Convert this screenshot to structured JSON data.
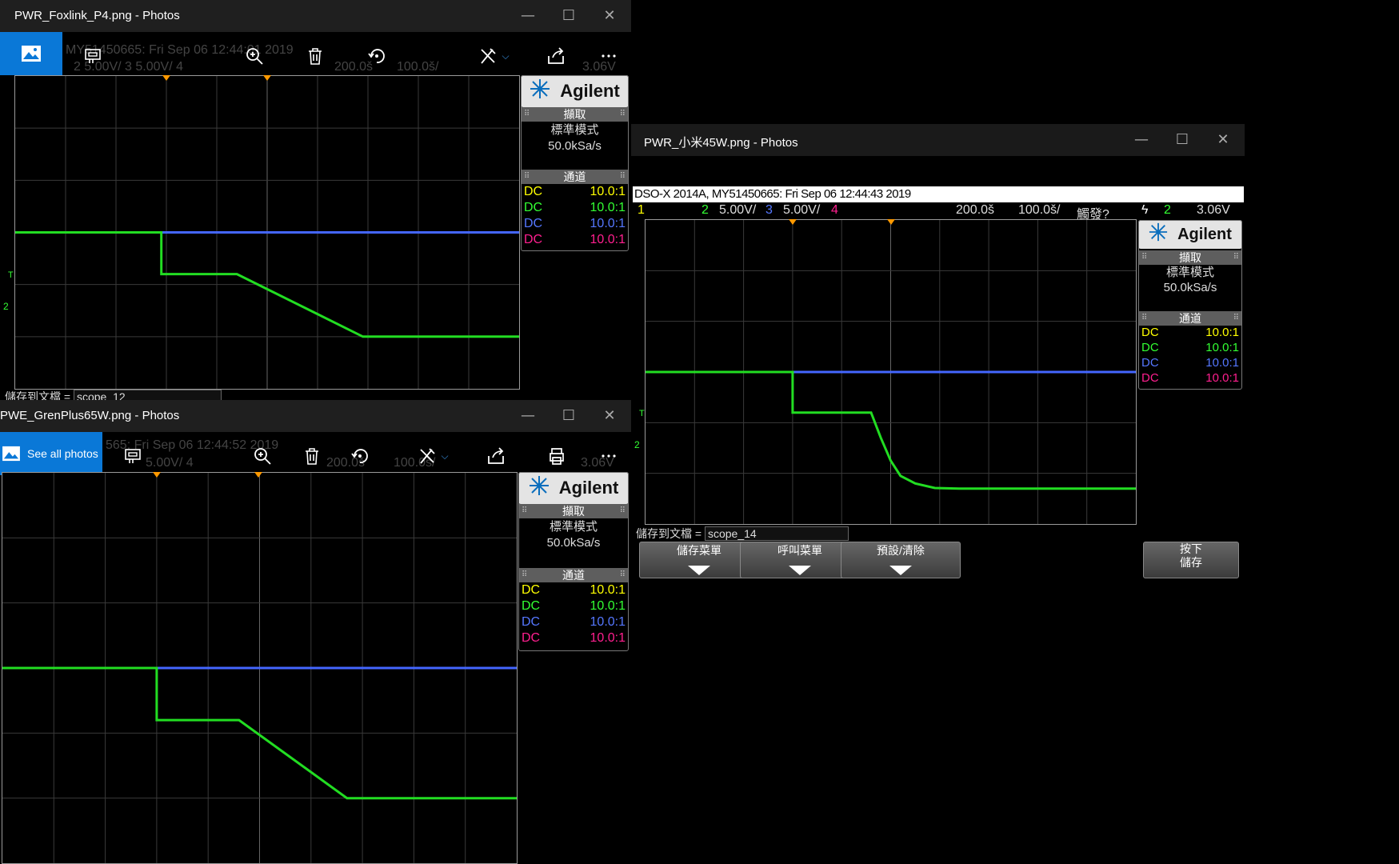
{
  "windows": {
    "foxlink": {
      "title": "PWR_Foxlink_P4.png - Photos",
      "ghost_header": "MY51450665: Fri Sep 06 12:44:01 2019",
      "ghost_status": "2   5.00V/   3   5.00V/   4",
      "ghost_time": "200.0š",
      "ghost_pos": "100.0š/",
      "ghost_trig": "3.06V",
      "save_label": "儲存到文檔 =",
      "save_value": "scope_12",
      "panel": {
        "brand": "Agilent",
        "acq_header": "擷取",
        "mode": "標準模式",
        "rate": "50.0kSa/s",
        "ch_header": "通道",
        "channels": [
          {
            "coupling": "DC",
            "ratio": "10.0:1"
          },
          {
            "coupling": "DC",
            "ratio": "10.0:1"
          },
          {
            "coupling": "DC",
            "ratio": "10.0:1"
          },
          {
            "coupling": "DC",
            "ratio": "10.0:1"
          }
        ]
      }
    },
    "grenplus": {
      "title": "PWE_GrenPlus65W.png - Photos",
      "see_all": "See all photos",
      "ghost_header": "565: Fri Sep 06 12:44:52 2019",
      "ghost_status": "5.00V/   4",
      "ghost_time": "200.0š",
      "ghost_pos": "100.0š/",
      "ghost_trig": "3.06V",
      "panel": {
        "brand": "Agilent",
        "acq_header": "擷取",
        "mode": "標準模式",
        "rate": "50.0kSa/s",
        "ch_header": "通道",
        "channels": [
          {
            "coupling": "DC",
            "ratio": "10.0:1"
          },
          {
            "coupling": "DC",
            "ratio": "10.0:1"
          },
          {
            "coupling": "DC",
            "ratio": "10.0:1"
          },
          {
            "coupling": "DC",
            "ratio": "10.0:1"
          }
        ]
      }
    },
    "xiaomi": {
      "title": "PWR_小米45W.png - Photos",
      "header": "DSO-X 2014A, MY51450665: Fri Sep 06 12:44:43 2019",
      "status": {
        "ch1": "1",
        "ch2": "2",
        "ch2_scale": "5.00V/",
        "ch3": "3",
        "ch3_scale": "5.00V/",
        "ch4": "4",
        "time_scale": "200.0š",
        "delay": "100.0š/",
        "trig_status": "觸發?",
        "trig_icon": "ϟ",
        "trig_ch": "2",
        "trig_level": "3.06V"
      },
      "save_label": "儲存到文檔 =",
      "save_value": "scope_14",
      "buttons": [
        "儲存菜單",
        "呼叫菜單",
        "預設/清除"
      ],
      "press_button": [
        "按下",
        "儲存"
      ],
      "panel": {
        "brand": "Agilent",
        "acq_header": "擷取",
        "mode": "標準模式",
        "rate": "50.0kSa/s",
        "ch_header": "通道",
        "channels": [
          {
            "coupling": "DC",
            "ratio": "10.0:1"
          },
          {
            "coupling": "DC",
            "ratio": "10.0:1"
          },
          {
            "coupling": "DC",
            "ratio": "10.0:1"
          },
          {
            "coupling": "DC",
            "ratio": "10.0:1"
          }
        ]
      }
    }
  },
  "window_controls": {
    "minimize": "—",
    "maximize": "☐",
    "close": "✕"
  },
  "toolbar_icons": [
    "photo-icon",
    "slideshow-icon",
    "zoom-icon",
    "delete-icon",
    "rotate-icon",
    "edit-icon",
    "share-icon",
    "print-icon",
    "more-icon"
  ],
  "colors": {
    "ch1": "#ffff00",
    "ch2": "#33ff33",
    "ch3": "#5577ff",
    "ch4": "#ff1f8f",
    "accent": "#0a78d7",
    "trace_green": "#22dd22",
    "trace_blue": "#4466ff",
    "marker": "#ff9900"
  },
  "chart_data": [
    {
      "type": "line",
      "title": "",
      "xlabel": "",
      "ylabel": "",
      "x_divisions": 10,
      "y_divisions": 6,
      "series": [
        {
          "x": [
            0,
            2.9,
            2.9,
            4.4,
            6.9,
            10
          ],
          "y": [
            3.0,
            3.0,
            3.8,
            3.8,
            5.0,
            5.0
          ]
        },
        {
          "x": [
            0,
            10
          ],
          "y": [
            3.0,
            3.0
          ]
        }
      ]
    },
    {
      "type": "line",
      "title": "",
      "xlabel": "",
      "ylabel": "",
      "x_divisions": 10,
      "y_divisions": 6,
      "series": [
        {
          "x": [
            0,
            3.0,
            3.0,
            4.6,
            6.7,
            10
          ],
          "y": [
            3.0,
            3.0,
            3.8,
            3.8,
            5.0,
            5.0
          ]
        },
        {
          "x": [
            0,
            10
          ],
          "y": [
            3.0,
            3.0
          ]
        }
      ]
    },
    {
      "type": "line",
      "title": "",
      "xlabel": "",
      "ylabel": "",
      "x_divisions": 10,
      "y_divisions": 6,
      "series": [
        {
          "x": [
            0,
            3.0,
            3.0,
            4.6,
            4.8,
            5.0,
            5.2,
            5.5,
            5.9,
            6.4,
            10
          ],
          "y": [
            3.0,
            3.0,
            3.8,
            3.8,
            4.3,
            4.75,
            5.05,
            5.2,
            5.29,
            5.3,
            5.3
          ]
        },
        {
          "x": [
            0,
            10
          ],
          "y": [
            3.0,
            3.0
          ]
        }
      ]
    }
  ]
}
